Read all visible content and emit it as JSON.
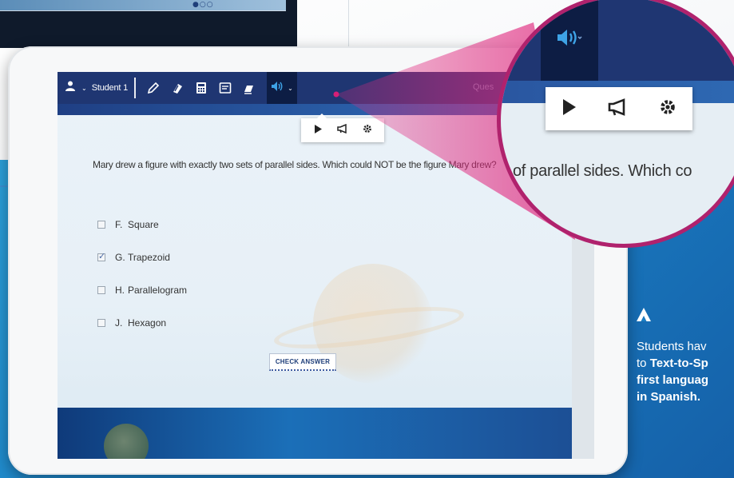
{
  "carousel": {
    "dots": "●○○"
  },
  "toolbar": {
    "student_name": "Student 1",
    "right_label": "Ques",
    "tools": [
      "pencil-icon",
      "eraser-icon",
      "calculator-icon",
      "notepad-icon",
      "highlighter-icon"
    ]
  },
  "tts_popover": {
    "buttons": [
      "play-icon",
      "megaphone-icon",
      "gear-icon"
    ]
  },
  "question": {
    "text": "Mary drew a figure with exactly two sets of parallel sides. Which could NOT be the figure Mary drew?",
    "options": [
      {
        "letter": "F.",
        "label": "Square",
        "checked": false
      },
      {
        "letter": "G.",
        "label": "Trapezoid",
        "checked": true
      },
      {
        "letter": "H.",
        "label": "Parallelogram",
        "checked": false
      },
      {
        "letter": "J.",
        "label": "Hexagon",
        "checked": false
      }
    ],
    "check_answer_label": "CHECK ANSWER"
  },
  "zoom": {
    "text": "s of parallel sides. Which co"
  },
  "caption": {
    "line1": "Students hav",
    "line2_prefix": "to ",
    "line2_bold": "Text-to-Sp",
    "line3_bold": "first languag",
    "line4_bold": "in Spanish."
  },
  "colors": {
    "toolbar": "#1f3672",
    "speaker_active": "#0d1d44",
    "callout_border": "#b0226d",
    "panel_blue": "#1a7fc4"
  }
}
